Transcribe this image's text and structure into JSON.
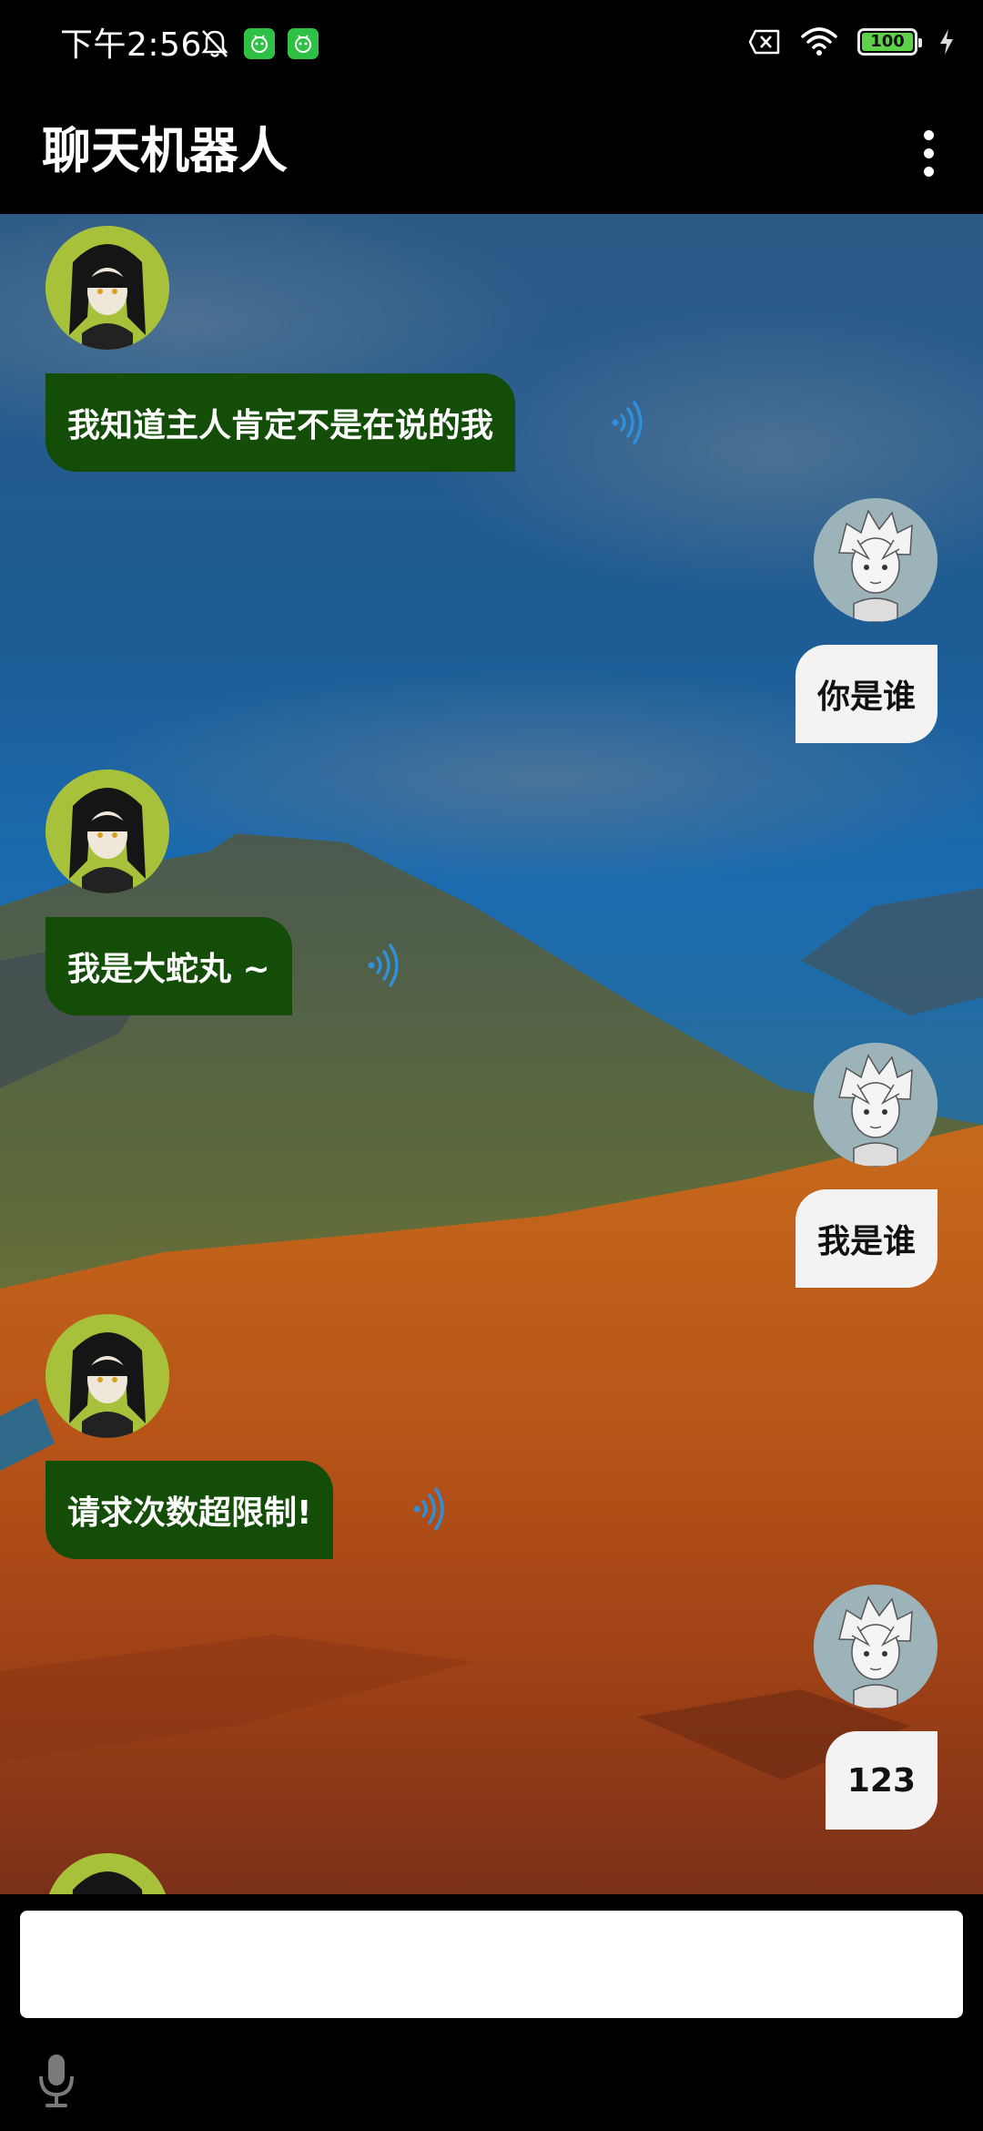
{
  "status_bar": {
    "time": "下午2:56",
    "battery": "100"
  },
  "app_bar": {
    "title": "聊天机器人"
  },
  "messages": [
    {
      "sender": "bot",
      "text": "我知道主人肯定不是在说的我"
    },
    {
      "sender": "user",
      "text": "你是谁"
    },
    {
      "sender": "bot",
      "text": "我是大蛇丸 ~"
    },
    {
      "sender": "user",
      "text": "我是谁"
    },
    {
      "sender": "bot",
      "text": "请求次数超限制!"
    },
    {
      "sender": "user",
      "text": "123"
    }
  ],
  "input": {
    "placeholder": ""
  },
  "icons": {
    "bot_avatar": "orochimaru-avatar",
    "user_avatar": "white-hair-boy-avatar",
    "voice": "voice-wave-icon",
    "mic": "microphone-icon",
    "menu": "more-vertical-icon"
  },
  "colors": {
    "bot_bubble": "#134d07",
    "user_bubble": "#f3f3f3",
    "voice_icon": "#2f8fd8"
  }
}
